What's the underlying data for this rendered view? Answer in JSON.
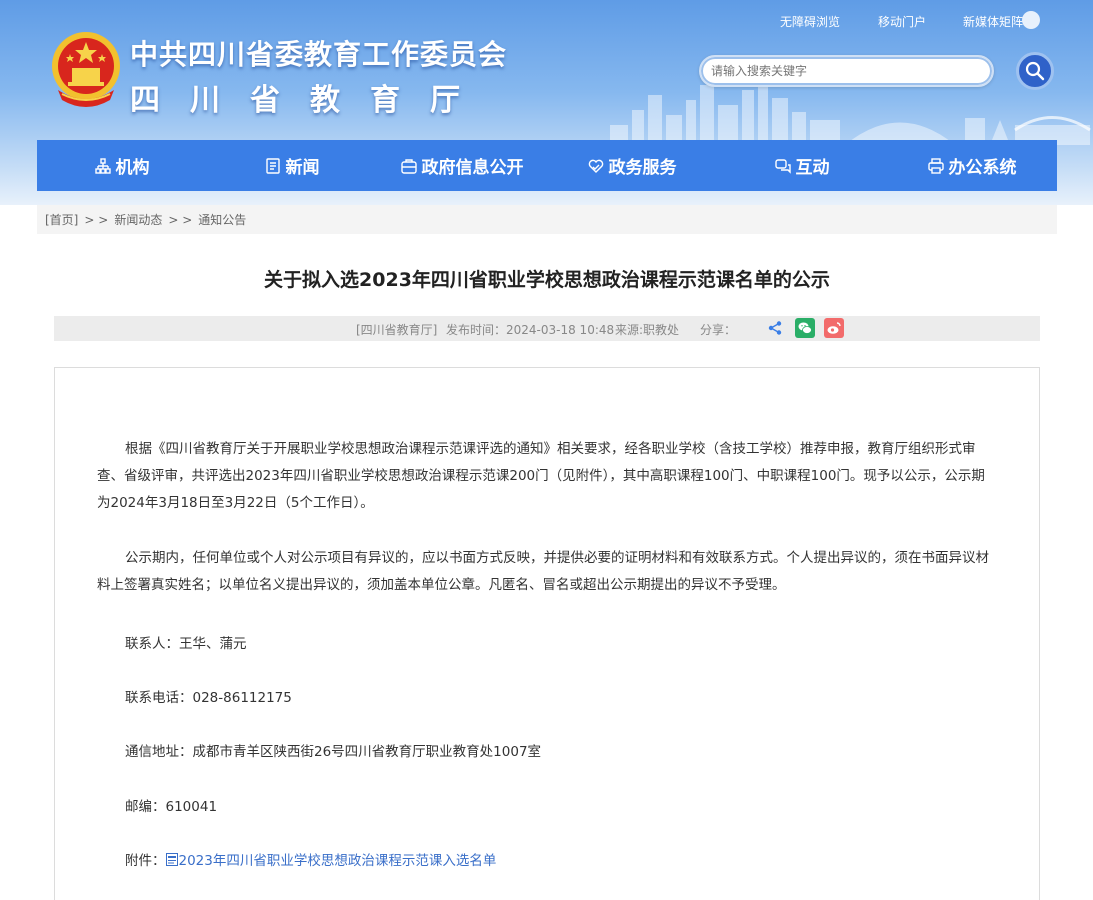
{
  "header": {
    "title": "中共四川省委教育工作委员会",
    "subtitle": "四川省教育厅",
    "top_links": [
      "无障碍浏览",
      "移动门户",
      "新媒体矩阵"
    ],
    "search_placeholder": "请输入搜索关键字"
  },
  "nav": {
    "items": [
      {
        "label": "机构",
        "icon": "org-icon"
      },
      {
        "label": "新闻",
        "icon": "news-icon"
      },
      {
        "label": "政府信息公开",
        "icon": "info-open-icon"
      },
      {
        "label": "政务服务",
        "icon": "service-icon"
      },
      {
        "label": "互动",
        "icon": "chat-icon"
      },
      {
        "label": "办公系统",
        "icon": "printer-icon"
      }
    ],
    "color": "#3a7ee6"
  },
  "breadcrumb": {
    "home": "[首页]",
    "sep": "> >",
    "items": [
      "新闻动态",
      "通知公告"
    ]
  },
  "article": {
    "title": "关于拟入选2023年四川省职业学校思想政治课程示范课名单的公示",
    "meta": {
      "source_tag": "[四川省教育厅]",
      "publish_time": "发布时间：2024-03-18 10:48",
      "source": "来源:职教处",
      "share_label": "分享："
    },
    "paragraphs": [
      "根据《四川省教育厅关于开展职业学校思想政治课程示范课评选的通知》相关要求，经各职业学校（含技工学校）推荐申报，教育厅组织形式审查、省级评审，共评选出2023年四川省职业学校思想政治课程示范课200门（见附件），其中高职课程100门、中职课程100门。现予以公示，公示期为2024年3月18日至3月22日（5个工作日）。",
      "公示期内，任何单位或个人对公示项目有异议的，应以书面方式反映，并提供必要的证明材料和有效联系方式。个人提出异议的，须在书面异议材料上签署真实姓名；以单位名义提出异议的，须加盖本单位公章。凡匿名、冒名或超出公示期提出的异议不予受理。"
    ],
    "contact": "联系人：王华、蒲元",
    "phone": "联系电话：028-86112175",
    "address": "通信地址：成都市青羊区陕西街26号四川省教育厅职业教育处1007室",
    "postcode": "邮编：610041",
    "attachment_label": "附件：",
    "attachment_link": "2023年四川省职业学校思想政治课程示范课入选名单"
  }
}
